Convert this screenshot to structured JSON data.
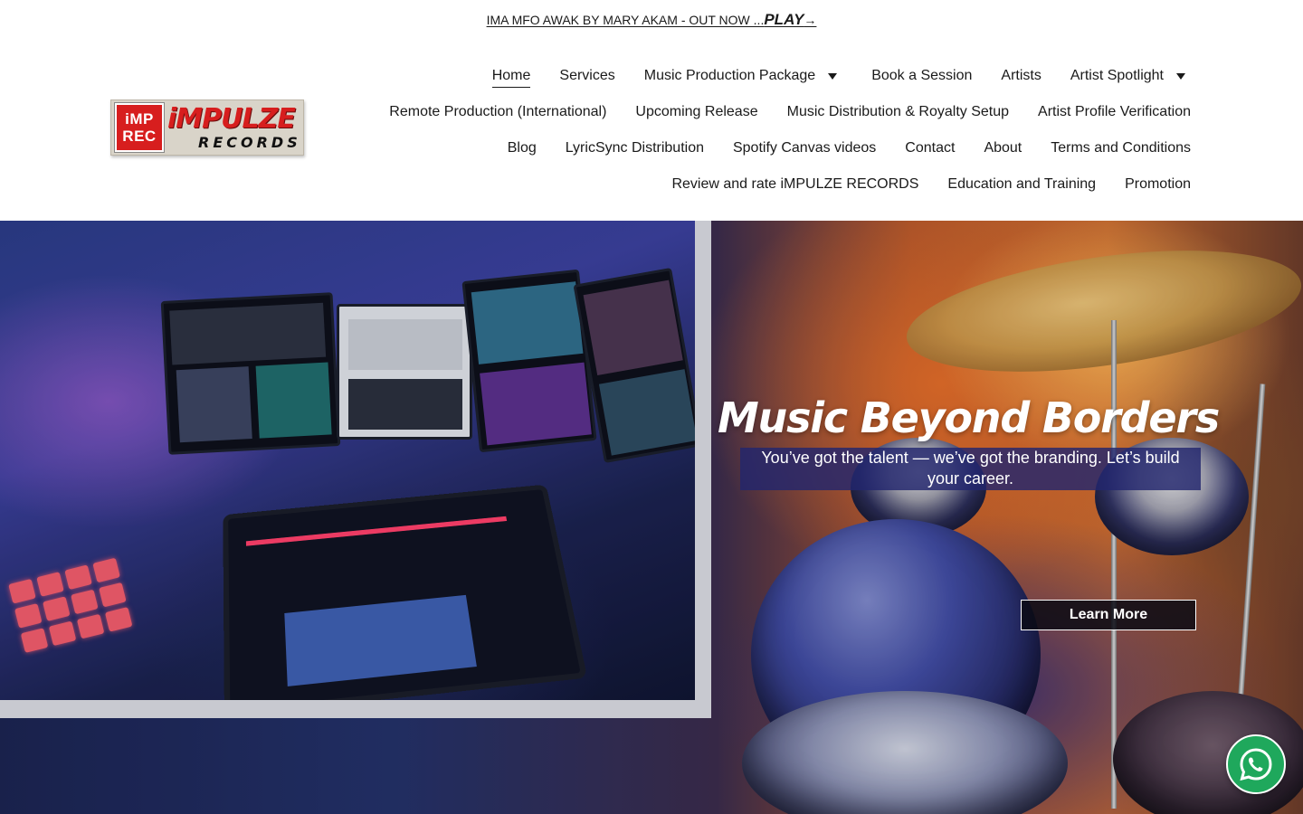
{
  "announcement": {
    "text": "IMA MFO AWAK BY MARY AKAM - OUT NOW ...",
    "play_label": "PLAY",
    "arrow": "→"
  },
  "logo": {
    "badge_line1": "iMP",
    "badge_line2": "REC",
    "brand": "iMPULZE",
    "sub": "RECORDS"
  },
  "nav": {
    "row1": [
      {
        "label": "Home"
      },
      {
        "label": "Services"
      },
      {
        "label": "Music Production Package"
      },
      {
        "label": "Book a Session"
      },
      {
        "label": "Artists"
      },
      {
        "label": "Artist Spotlight"
      }
    ],
    "row2": [
      {
        "label": "Remote Production (International)"
      },
      {
        "label": "Upcoming Release"
      },
      {
        "label": "Music Distribution & Royalty Setup"
      },
      {
        "label": "Artist Profile Verification"
      }
    ],
    "row3": [
      {
        "label": "Blog"
      },
      {
        "label": "LyricSync Distribution"
      },
      {
        "label": "Spotify Canvas videos"
      },
      {
        "label": "Contact"
      },
      {
        "label": "About"
      },
      {
        "label": "Terms and Conditions"
      }
    ],
    "row4": [
      {
        "label": "Review and rate iMPULZE RECORDS"
      },
      {
        "label": "Education and Training"
      },
      {
        "label": "Promotion"
      }
    ]
  },
  "hero": {
    "title": "Music Beyond Borders",
    "subtitle": "You’ve got the talent — we’ve got the branding. Let’s build your career.",
    "button_label": "Learn More"
  },
  "colors": {
    "accent_red": "#d71e1e",
    "subtitle_bg": "#22266e",
    "whatsapp_green": "#1fa85c"
  },
  "icons": {
    "dropdown": "caret-down-icon",
    "chat": "whatsapp-icon"
  }
}
